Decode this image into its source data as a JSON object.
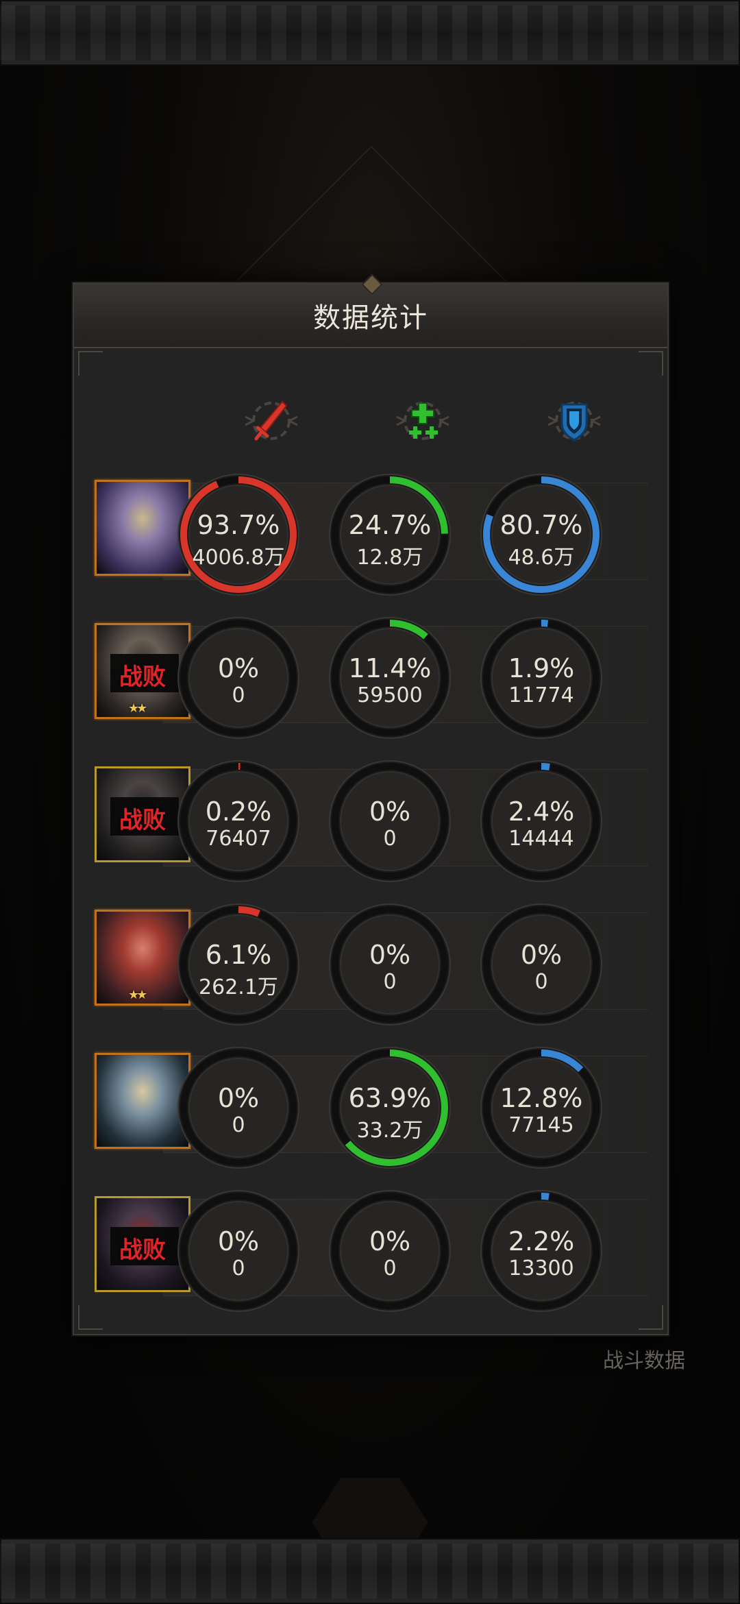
{
  "dialog": {
    "title": "数据统计"
  },
  "background": {
    "label": "战斗数据"
  },
  "columns": [
    {
      "name": "damage",
      "icon": "sword-icon",
      "color": "#d8362a"
    },
    {
      "name": "heal",
      "icon": "heal-cross-icon",
      "color": "#2fbf2f"
    },
    {
      "name": "defense",
      "icon": "shield-icon",
      "color": "#3a86d6"
    }
  ],
  "rows": [
    {
      "status": "",
      "stars": "",
      "frame": "orange",
      "stats": [
        {
          "pct": "93.7%",
          "val": "4006.8万",
          "fraction": 0.937
        },
        {
          "pct": "24.7%",
          "val": "12.8万",
          "fraction": 0.247
        },
        {
          "pct": "80.7%",
          "val": "48.6万",
          "fraction": 0.807
        }
      ]
    },
    {
      "status": "战败",
      "stars": "★★",
      "frame": "orange",
      "stats": [
        {
          "pct": "0%",
          "val": "0",
          "fraction": 0
        },
        {
          "pct": "11.4%",
          "val": "59500",
          "fraction": 0.114
        },
        {
          "pct": "1.9%",
          "val": "11774",
          "fraction": 0.019
        }
      ]
    },
    {
      "status": "战败",
      "stars": "",
      "frame": "gold",
      "stats": [
        {
          "pct": "0.2%",
          "val": "76407",
          "fraction": 0.002
        },
        {
          "pct": "0%",
          "val": "0",
          "fraction": 0
        },
        {
          "pct": "2.4%",
          "val": "14444",
          "fraction": 0.024
        }
      ]
    },
    {
      "status": "",
      "stars": "★★",
      "frame": "orange",
      "stats": [
        {
          "pct": "6.1%",
          "val": "262.1万",
          "fraction": 0.061
        },
        {
          "pct": "0%",
          "val": "0",
          "fraction": 0
        },
        {
          "pct": "0%",
          "val": "0",
          "fraction": 0
        }
      ]
    },
    {
      "status": "",
      "stars": "",
      "frame": "orange",
      "stats": [
        {
          "pct": "0%",
          "val": "0",
          "fraction": 0
        },
        {
          "pct": "63.9%",
          "val": "33.2万",
          "fraction": 0.639
        },
        {
          "pct": "12.8%",
          "val": "77145",
          "fraction": 0.128
        }
      ]
    },
    {
      "status": "战败",
      "stars": "",
      "frame": "gold",
      "stats": [
        {
          "pct": "0%",
          "val": "0",
          "fraction": 0
        },
        {
          "pct": "0%",
          "val": "0",
          "fraction": 0
        },
        {
          "pct": "2.2%",
          "val": "13300",
          "fraction": 0.022
        }
      ]
    }
  ]
}
